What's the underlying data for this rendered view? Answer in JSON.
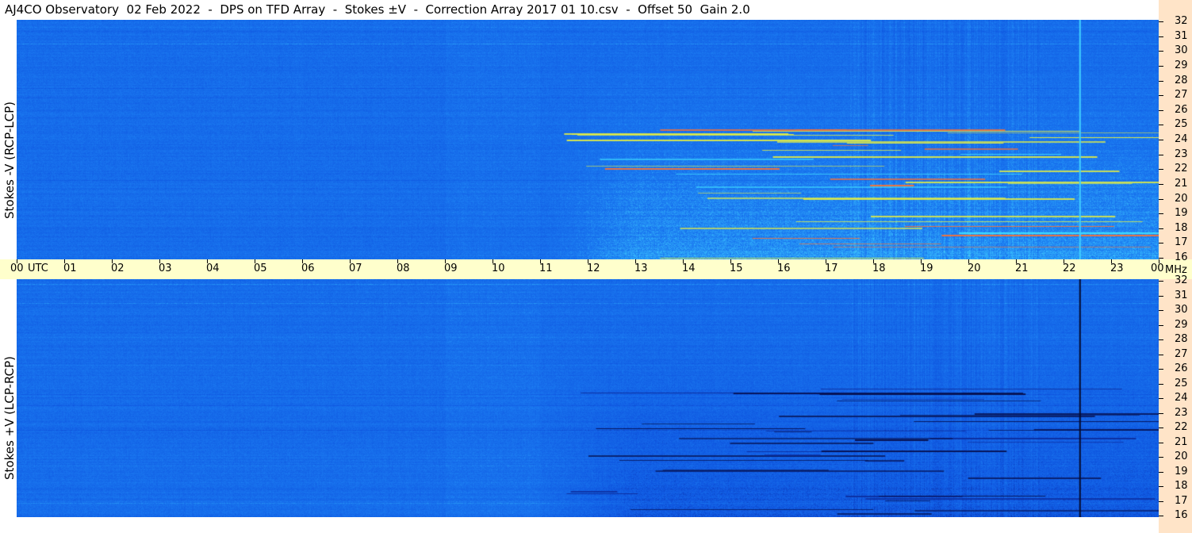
{
  "title": "AJ4CO Observatory  02 Feb 2022  -  DPS on TFD Array  -  Stokes ±V  -  Correction Array 2017 01 10.csv  -  Offset 50  Gain 2.0",
  "chart_data": {
    "type": "heatmap",
    "panels": [
      {
        "label": "Stokes -V (RCP-LCP)",
        "y_range_mhz": [
          16,
          32
        ]
      },
      {
        "label": "Stokes +V (LCP-RCP)",
        "y_range_mhz": [
          16,
          32
        ]
      }
    ],
    "x_axis": {
      "unit_label": "UTC",
      "ticks": [
        "00",
        "01",
        "02",
        "03",
        "04",
        "05",
        "06",
        "07",
        "08",
        "09",
        "10",
        "11",
        "12",
        "13",
        "14",
        "15",
        "16",
        "17",
        "18",
        "19",
        "20",
        "21",
        "22",
        "23",
        "00"
      ],
      "range_hours": [
        0,
        24
      ]
    },
    "y_axis": {
      "unit_label": "MHz",
      "ticks": [
        "16",
        "17",
        "18",
        "19",
        "20",
        "21",
        "22",
        "23",
        "24",
        "25",
        "26",
        "27",
        "28",
        "29",
        "30",
        "31",
        "32"
      ]
    },
    "colormap": [
      "#0a2a9a",
      "#0f56e0",
      "#1a78f0",
      "#3cc8ff",
      "#e8f040",
      "#ff5020"
    ]
  }
}
